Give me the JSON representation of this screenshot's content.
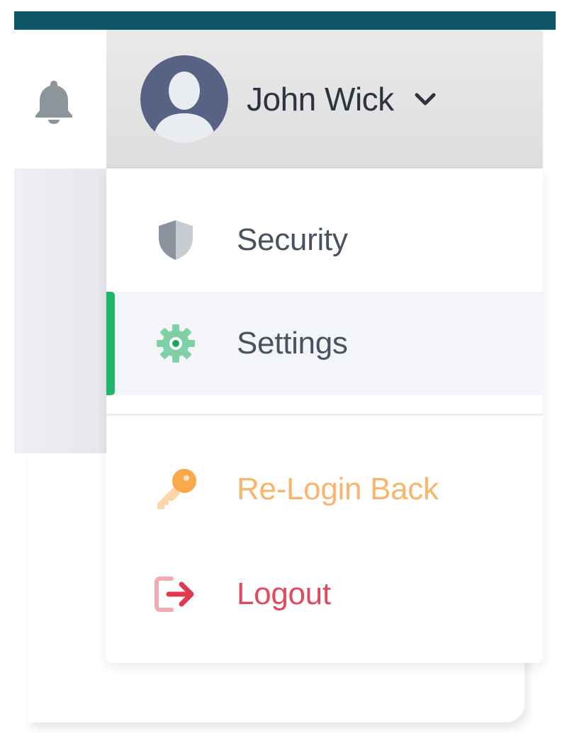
{
  "header": {
    "notifications_icon": "bell-icon",
    "user": {
      "name": "John Wick",
      "avatar_icon": "user-silhouette-icon",
      "toggle_icon": "chevron-down-icon"
    }
  },
  "menu": {
    "items": [
      {
        "label": "Security",
        "icon": "shield-icon",
        "active": false,
        "color": "#4a5260"
      },
      {
        "label": "Settings",
        "icon": "gear-icon",
        "active": true,
        "color": "#4a5260"
      },
      {
        "label": "Re-Login Back",
        "icon": "key-icon",
        "active": false,
        "color": "#f8b56b"
      },
      {
        "label": "Logout",
        "icon": "logout-icon",
        "active": false,
        "color": "#e04a5e"
      }
    ]
  },
  "colors": {
    "top_bar": "#0e5566",
    "active_indicator": "#1fb56b",
    "avatar_bg": "#566385",
    "settings_icon": "#7ed0a5"
  }
}
